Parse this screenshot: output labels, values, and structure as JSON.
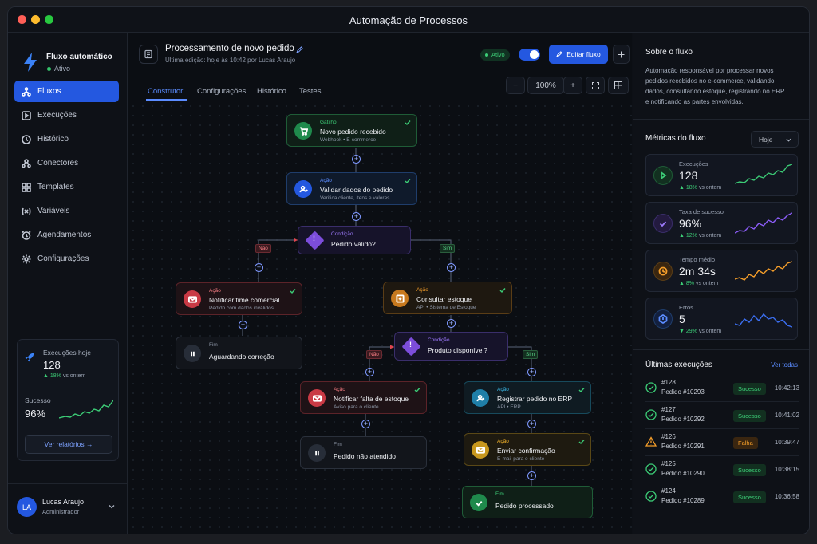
{
  "window": {
    "title": "Automação de Processos"
  },
  "brand": {
    "name": "Fluxo automático",
    "status": "Ativo"
  },
  "nav": [
    {
      "label": "Fluxos",
      "icon": "flow-icon",
      "active": true
    },
    {
      "label": "Execuções",
      "icon": "play-square-icon"
    },
    {
      "label": "Histórico",
      "icon": "clock-icon"
    },
    {
      "label": "Conectores",
      "icon": "plug-icon"
    },
    {
      "label": "Templates",
      "icon": "grid-icon"
    },
    {
      "label": "Variáveis",
      "icon": "variable-icon"
    },
    {
      "label": "Agendamentos",
      "icon": "alarm-icon"
    },
    {
      "label": "Configurações",
      "icon": "gear-icon"
    }
  ],
  "sidebar_stats": {
    "exec_label": "Execuções hoje",
    "exec_value": "128",
    "exec_delta": "18%",
    "exec_delta_suffix": "vs ontem",
    "success_label": "Sucesso",
    "success_value": "96%",
    "reports_button": "Ver relatórios →"
  },
  "user": {
    "initials": "LA",
    "name": "Lucas Araujo",
    "role": "Administrador"
  },
  "header": {
    "title": "Processamento de novo pedido",
    "subtitle": "Última edição: hoje às 10:42 por Lucas Araujo",
    "status": "Ativo",
    "edit_button": "Editar fluxo"
  },
  "tabs": [
    "Construtor",
    "Configurações",
    "Histórico",
    "Testes"
  ],
  "zoom": {
    "level": "100%",
    "minus": "−",
    "plus": "+"
  },
  "nodes": {
    "n1": {
      "kind": "Gatilho",
      "name": "Novo pedido recebido",
      "sub": "Webhook • E-commerce"
    },
    "n2": {
      "kind": "Ação",
      "name": "Validar dados do pedido",
      "sub": "Verifica cliente, itens e valores"
    },
    "n3": {
      "kind": "Condição",
      "name": "Pedido válido?"
    },
    "n4": {
      "kind": "Ação",
      "name": "Notificar time comercial",
      "sub": "Pedido com dados inválidos"
    },
    "n5": {
      "kind": "Fim",
      "name": "Aguardando correção"
    },
    "n6": {
      "kind": "Ação",
      "name": "Consultar estoque",
      "sub": "API • Sistema de Estoque"
    },
    "n7": {
      "kind": "Condição",
      "name": "Produto disponível?"
    },
    "n8": {
      "kind": "Ação",
      "name": "Notificar falta de estoque",
      "sub": "Aviso para o cliente"
    },
    "n9": {
      "kind": "Fim",
      "name": "Pedido não atendido"
    },
    "n10": {
      "kind": "Ação",
      "name": "Registrar pedido no ERP",
      "sub": "API • ERP"
    },
    "n11": {
      "kind": "Ação",
      "name": "Enviar confirmação",
      "sub": "E-mail para o cliente"
    },
    "n12": {
      "kind": "Fim",
      "name": "Pedido processado"
    }
  },
  "branch_labels": {
    "no": "Não",
    "yes": "Sim"
  },
  "about": {
    "title": "Sobre o fluxo",
    "text": "Automação responsável por processar novos pedidos recebidos no e-commerce, validando dados, consultando estoque, registrando no ERP e notificando as partes envolvidas."
  },
  "metrics": {
    "title": "Métricas do fluxo",
    "period": "Hoje",
    "items": [
      {
        "label": "Execuções",
        "value": "128",
        "delta": "18%",
        "suffix": "vs ontem",
        "color": "#3ccc76"
      },
      {
        "label": "Taxa de sucesso",
        "value": "96%",
        "delta": "12%",
        "suffix": "vs ontem",
        "color": "#8b5cf6"
      },
      {
        "label": "Tempo médio",
        "value": "2m 34s",
        "delta": "8%",
        "suffix": "vs ontem",
        "color": "#f59e2a"
      },
      {
        "label": "Erros",
        "value": "5",
        "delta": "29%",
        "suffix": "vs ontem",
        "color": "#3b6ef0"
      }
    ]
  },
  "executions": {
    "title": "Últimas execuções",
    "link": "Ver todas",
    "items": [
      {
        "id": "#128",
        "order": "Pedido #10293",
        "status": "Sucesso",
        "time": "10:42:13"
      },
      {
        "id": "#127",
        "order": "Pedido #10292",
        "status": "Sucesso",
        "time": "10:41:02"
      },
      {
        "id": "#126",
        "order": "Pedido #10291",
        "status": "Falha",
        "time": "10:39:47"
      },
      {
        "id": "#125",
        "order": "Pedido #10290",
        "status": "Sucesso",
        "time": "10:38:15"
      },
      {
        "id": "#124",
        "order": "Pedido #10289",
        "status": "Sucesso",
        "time": "10:36:58"
      }
    ]
  },
  "colors": {
    "accent": "#2458e0",
    "success": "#3ccc76",
    "danger": "#e0454f",
    "warning": "#f59e2a",
    "purple": "#7c4ddb"
  }
}
